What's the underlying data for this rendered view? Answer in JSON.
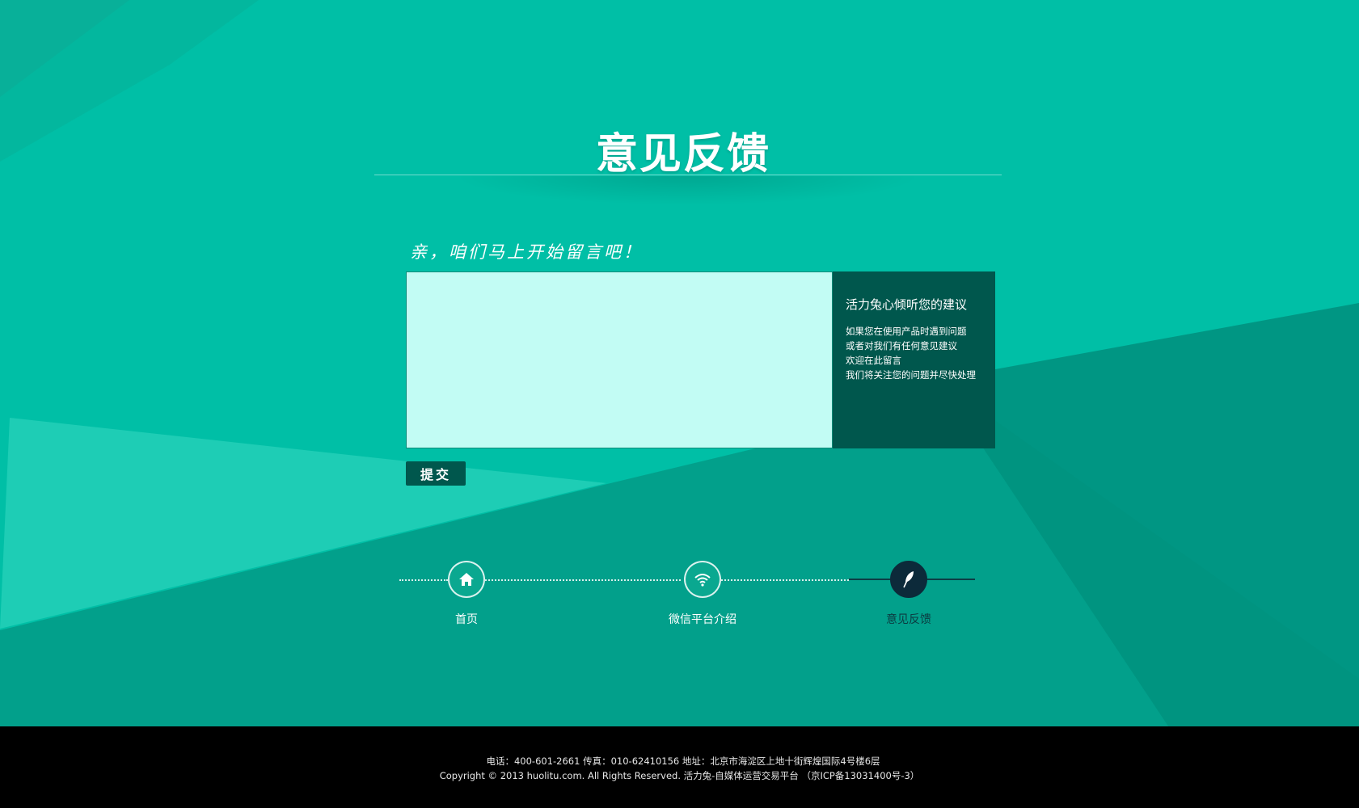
{
  "page": {
    "title": "意见反馈",
    "prompt": "亲，咱们马上开始留言吧！"
  },
  "form": {
    "textarea_value": "",
    "textarea_placeholder": "",
    "submit_label": "提交"
  },
  "side_panel": {
    "title": "活力兔心倾听您的建议",
    "lines": [
      "如果您在使用产品时遇到问题",
      "或者对我们有任何意见建议",
      "欢迎在此留言",
      "我们将关注您的问题并尽快处理"
    ]
  },
  "nav": {
    "items": [
      {
        "label": "首页",
        "icon": "home-icon",
        "active": false
      },
      {
        "label": "微信平台介绍",
        "icon": "wifi-icon",
        "active": false
      },
      {
        "label": "意见反馈",
        "icon": "feather-icon",
        "active": true
      }
    ]
  },
  "footer": {
    "line1": "电话：400-601-2661 传真：010-62410156 地址：北京市海淀区上地十街辉煌国际4号楼6层",
    "line2": "Copyright © 2013 huolitu.com. All Rights Reserved. 活力兔-自媒体运营交易平台 （京ICP备13031400号-3）"
  },
  "colors": {
    "background": "#00bfa6",
    "textarea_bg": "#c2fcf4",
    "panel_bg": "#00574d",
    "active_nav": "#0c2a3a",
    "footer_bg": "#000000"
  }
}
